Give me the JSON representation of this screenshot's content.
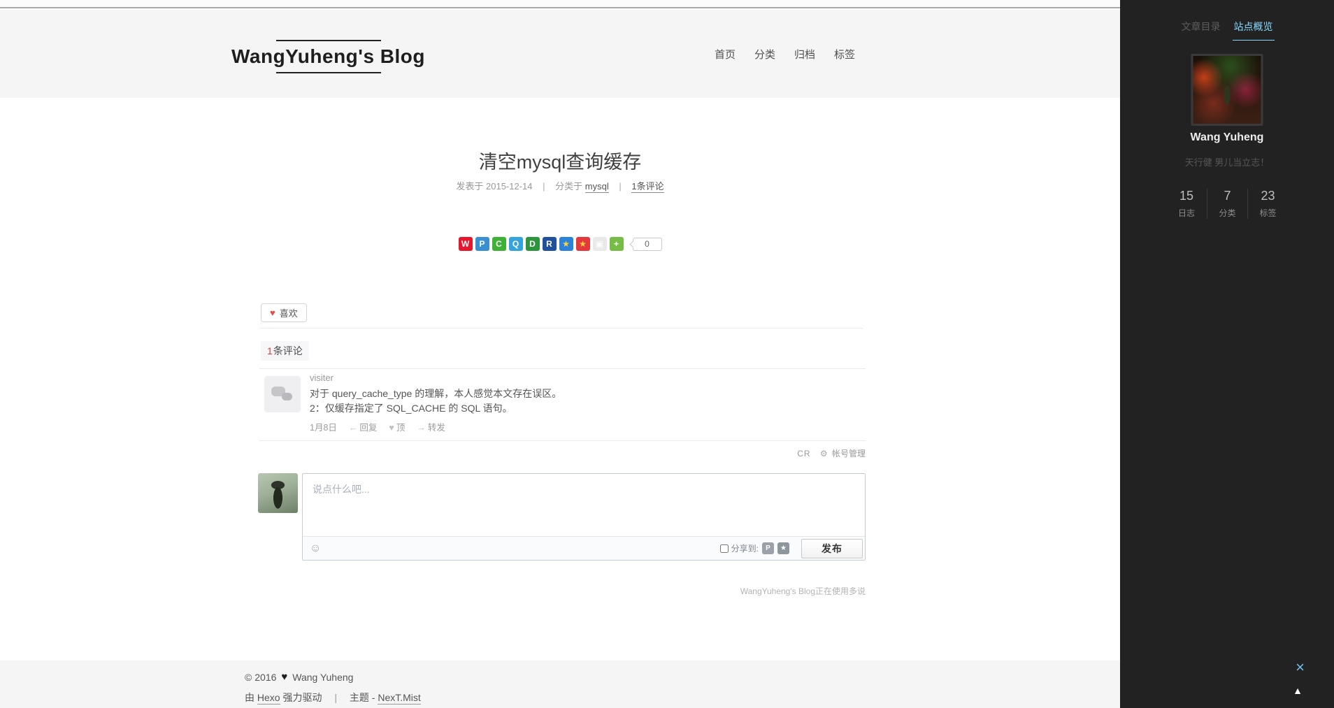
{
  "header": {
    "title": "WangYuheng's Blog",
    "nav": [
      {
        "label": "首页"
      },
      {
        "label": "分类"
      },
      {
        "label": "归档"
      },
      {
        "label": "标签"
      }
    ]
  },
  "post": {
    "title": "清空mysql查询缓存",
    "meta": {
      "published_label": "发表于",
      "date": "2015-12-14",
      "sep1": "|",
      "category_label": "分类于",
      "category_link": "mysql",
      "sep2": "|",
      "comments_link": "1条评论"
    },
    "share": {
      "icons": [
        {
          "name": "sina-weibo",
          "glyph": "W",
          "color": "#e6162d"
        },
        {
          "name": "tencent-pengyou",
          "glyph": "P",
          "color": "#3a8fd0"
        },
        {
          "name": "wechat",
          "glyph": "C",
          "color": "#3db237"
        },
        {
          "name": "qq",
          "glyph": "Q",
          "color": "#34a5dc"
        },
        {
          "name": "douban",
          "glyph": "D",
          "color": "#2d963d"
        },
        {
          "name": "renren",
          "glyph": "R",
          "color": "#20509e"
        },
        {
          "name": "qzone",
          "glyph": "★",
          "color": "#2b82d9",
          "glyph_color": "#ffd53e"
        },
        {
          "name": "baidu-space",
          "glyph": "★",
          "color": "#e3393c",
          "glyph_color": "#ffd53e"
        },
        {
          "name": "copy",
          "glyph": "▣",
          "color": "#e9e9e9",
          "glyph_color": "#ffffff"
        },
        {
          "name": "more",
          "glyph": "+",
          "color": "#76bd48"
        }
      ],
      "count": "0"
    },
    "like_icon": "♥",
    "like_label": "喜欢"
  },
  "comments": {
    "header_count": "1",
    "header_label": "条评论",
    "items": [
      {
        "author": "visiter",
        "lines": [
          "对于 query_cache_type 的理解，本人感觉本文存在误区。",
          "2：仅缓存指定了 SQL_CACHE 的 SQL 语句。"
        ],
        "date": "1月8日",
        "reply_icon": "←",
        "reply_label": "回复",
        "up_icon": "♥",
        "up_label": "顶",
        "forward_icon": "→",
        "forward_label": "转发"
      }
    ],
    "account": {
      "logo": "CR",
      "gear_icon": "⚙",
      "manage_label": "帐号管理"
    },
    "form": {
      "placeholder": "说点什么吧...",
      "smiley_icon": "☺",
      "share_to_label": "分享到:",
      "share_icons": [
        {
          "name": "pengyou",
          "glyph": "P",
          "color": "#9aa1a9"
        },
        {
          "name": "qzone",
          "glyph": "★",
          "color": "#8d959d"
        }
      ],
      "publish_label": "发布"
    },
    "powered_by": "WangYuheng's Blog正在使用多说"
  },
  "footer": {
    "copyright": "© 2016",
    "heart_icon": "♥",
    "author": "Wang Yuheng",
    "powered_prefix": "由",
    "powered_link": "Hexo",
    "powered_suffix": "强力驱动",
    "sep": "|",
    "theme_label": "主题",
    "theme_dash": "-",
    "theme_name": "NexT.Mist"
  },
  "sidebar": {
    "tabs": [
      {
        "label": "文章目录",
        "active": false
      },
      {
        "label": "站点概览",
        "active": true
      }
    ],
    "author": "Wang Yuheng",
    "motto": "天行健 男儿当立志！",
    "stats": [
      {
        "value": "15",
        "label": "日志"
      },
      {
        "value": "7",
        "label": "分类"
      },
      {
        "value": "23",
        "label": "标签"
      }
    ],
    "close_icon": "×",
    "back_to_top_icon": "▲",
    "accent_color": "#87daff"
  }
}
